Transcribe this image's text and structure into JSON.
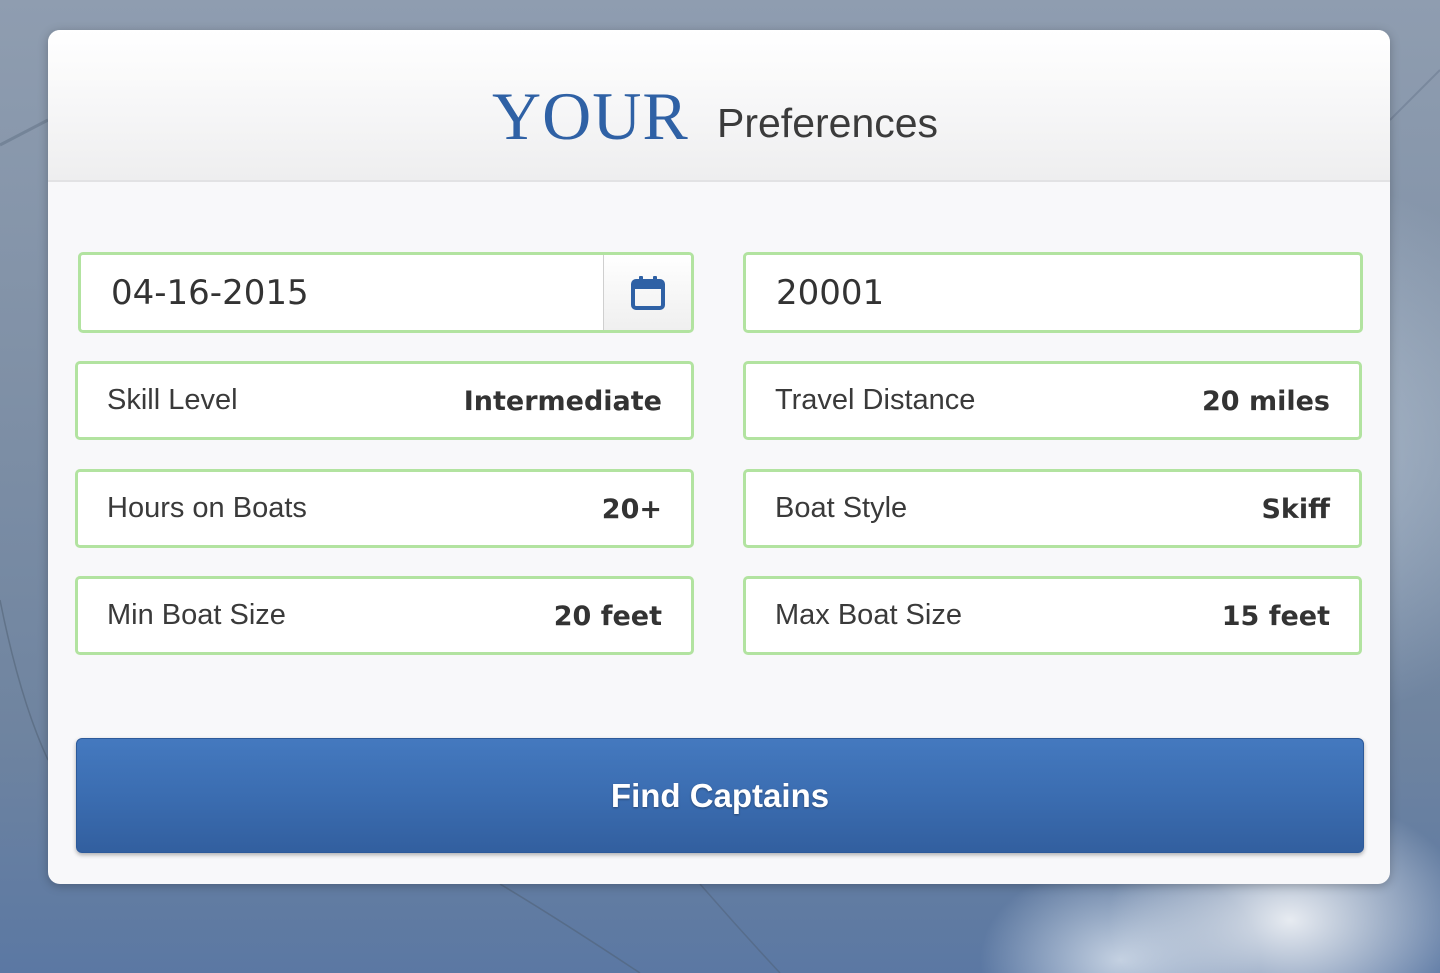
{
  "header": {
    "title_emphasis": "YOUR",
    "title_rest": "Preferences"
  },
  "date_field": {
    "value": "04-16-2015",
    "icon": "calendar-icon"
  },
  "zip_field": {
    "value": "20001"
  },
  "preferences": [
    {
      "label": "Skill Level",
      "value": "Intermediate"
    },
    {
      "label": "Travel Distance",
      "value": "20 miles"
    },
    {
      "label": "Hours on Boats",
      "value": "20+"
    },
    {
      "label": "Boat Style",
      "value": "Skiff"
    },
    {
      "label": "Min Boat Size",
      "value": "20 feet"
    },
    {
      "label": "Max Boat Size",
      "value": "15 feet"
    }
  ],
  "actions": {
    "find_label": "Find Captains"
  },
  "colors": {
    "accent": "#2f61a5",
    "field_border": "#b2e3a0",
    "button": "#3b6db1"
  }
}
